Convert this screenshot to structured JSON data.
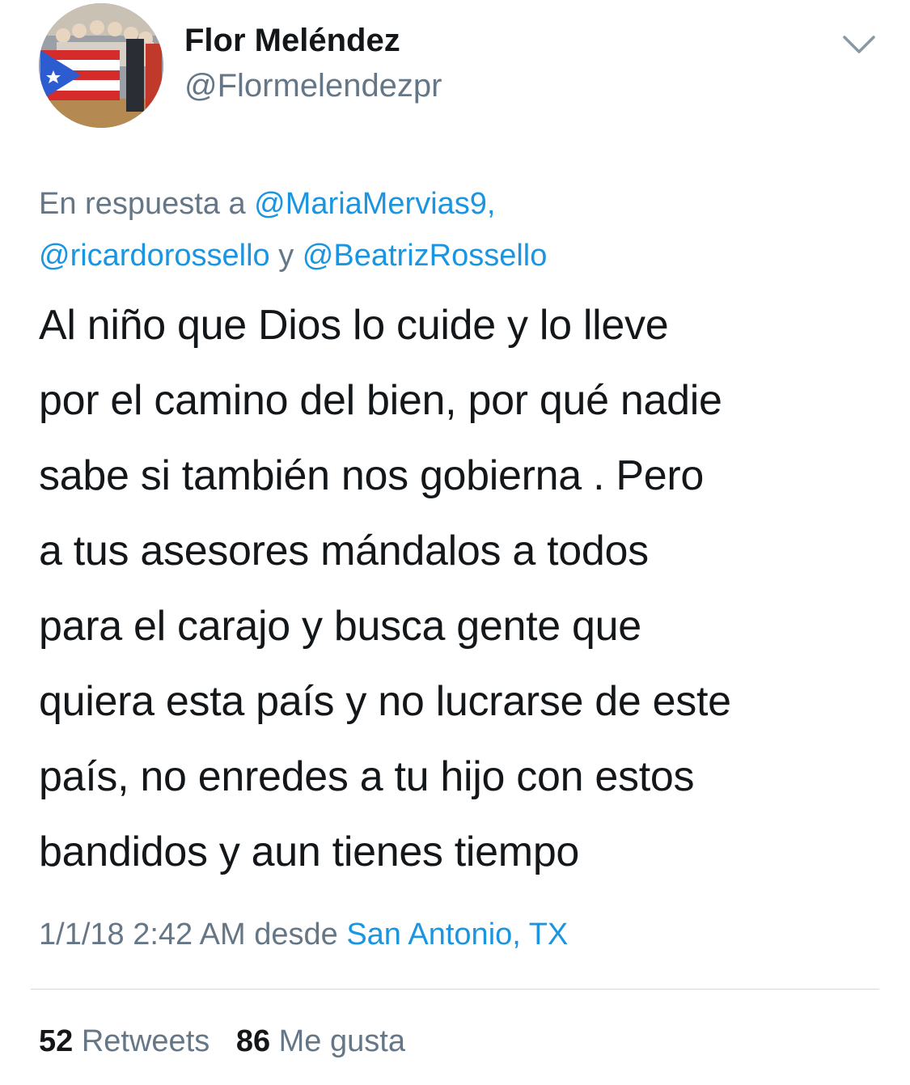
{
  "tweet": {
    "author": {
      "display_name": "Flor Meléndez",
      "handle": "@Flormelendezpr",
      "avatar_icon": "profile-photo-with-puerto-rico-flag"
    },
    "menu_icon": "chevron-down-icon",
    "reply_prefix": "En respuesta a",
    "reply_mentions": [
      "@MariaMervias9,",
      "@ricardorossello",
      "@BeatrizRossello"
    ],
    "reply_conjunction": "y",
    "text_lines": [
      "Al niño que Dios lo cuide y lo lleve",
      "por el camino del bien, por qué nadie",
      "sabe si también nos gobierna . Pero",
      "a tus asesores mándalos a todos",
      "para el carajo y busca gente que",
      "quiera esta país y no lucrarse de este",
      "país, no enredes a tu hijo con estos",
      "bandidos y aun tienes tiempo"
    ],
    "timestamp": "1/1/18 2:42 AM",
    "source_prefix": "desde",
    "location": "San Antonio, TX",
    "retweets_count": "52",
    "retweets_label": "Retweets",
    "likes_count": "86",
    "likes_label": "Me gusta"
  },
  "colors": {
    "link": "#1b95e0",
    "secondary_text": "#657786",
    "primary_text": "#14171a",
    "divider": "#d3d8dd"
  }
}
